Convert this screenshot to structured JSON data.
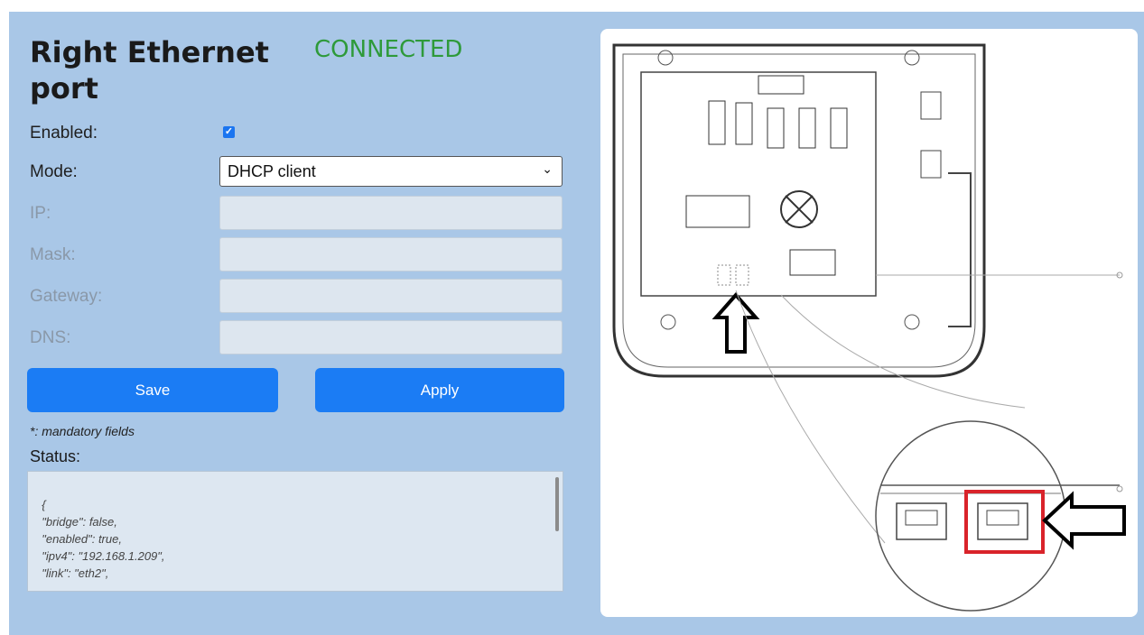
{
  "port": {
    "title": "Right Ethernet port",
    "status": "CONNECTED",
    "status_color": "#2e9a3a"
  },
  "form": {
    "enabled_label": "Enabled:",
    "enabled_checked": true,
    "mode_label": "Mode:",
    "mode_value": "DHCP client",
    "ip_label": "IP:",
    "mask_label": "Mask:",
    "gateway_label": "Gateway:",
    "dns_label": "DNS:",
    "ip_value": "",
    "mask_value": "",
    "gateway_value": "",
    "dns_value": ""
  },
  "buttons": {
    "save_label": "Save",
    "apply_label": "Apply",
    "accent": "#1b7cf4"
  },
  "footer": {
    "note": "*: mandatory fields",
    "status_label": "Status:",
    "status_json": "{\n  \"bridge\": false,\n  \"enabled\": true,\n  \"ipv4\": \"192.168.1.209\",\n  \"link\": \"eth2\","
  },
  "diagram": {
    "highlight_color": "#d9232a",
    "icons": [
      "arrow-up-icon",
      "arrow-left-icon"
    ]
  }
}
